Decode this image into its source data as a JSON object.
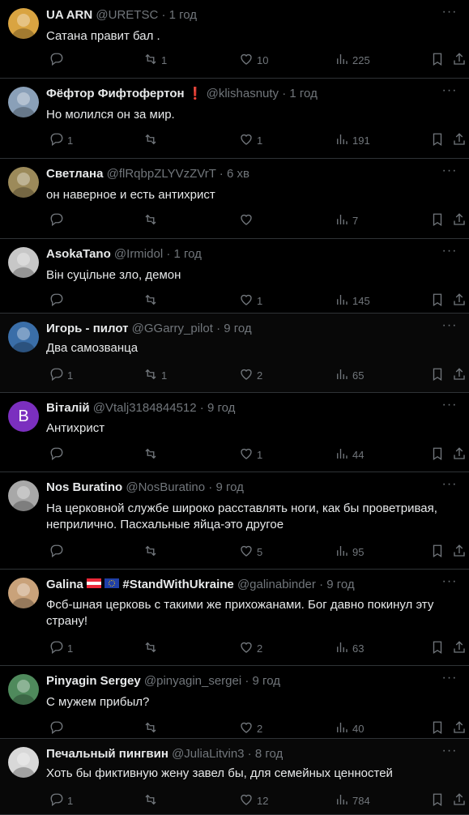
{
  "tweets": [
    {
      "name": "UA ARN",
      "handle": "@URETSC",
      "time": "1 год",
      "text": "Сатана правит бал .",
      "replies": "",
      "retweets": "1",
      "likes": "10",
      "views": "225",
      "avatar_color": "#d9a441"
    },
    {
      "name": "Фёфтор Фифтофертон",
      "handle": "@klishasnuty",
      "time": "1 год",
      "text": "Но молился он за мир.",
      "replies": "1",
      "retweets": "",
      "likes": "1",
      "views": "191",
      "avatar_color": "#8aa0b8",
      "badge": "❗"
    },
    {
      "name": "Светлана",
      "handle": "@flRqbpZLYVzZVrT",
      "time": "6 хв",
      "text": "он наверное и есть антихрист",
      "replies": "",
      "retweets": "",
      "likes": "",
      "views": "7",
      "avatar_color": "#9c8a5a"
    },
    {
      "name": "AsokaTano",
      "handle": "@Irmidol",
      "time": "1 год",
      "text": "Він суцільне зло, демон",
      "replies": "",
      "retweets": "",
      "likes": "1",
      "views": "145",
      "avatar_color": "#c7c7c7"
    },
    {
      "name": "Игорь - пилот",
      "handle": "@GGarry_pilot",
      "time": "9 год",
      "text": "Два самозванца",
      "replies": "1",
      "retweets": "1",
      "likes": "2",
      "views": "65",
      "avatar_color": "#3a6ea8"
    },
    {
      "name": "Віталій",
      "handle": "@Vtalj3184844512",
      "time": "9 год",
      "text": "Антихрист",
      "replies": "",
      "retweets": "",
      "likes": "1",
      "views": "44",
      "avatar_color": "#7b2fbf",
      "avatar_letter": "B"
    },
    {
      "name": "Nos Buratino",
      "handle": "@NosBuratino",
      "time": "9 год",
      "text": "На церковной службе широко расставлять ноги, как бы проветривая, неприлично. Пасхальные яйца-это другое",
      "replies": "",
      "retweets": "",
      "likes": "5",
      "views": "95",
      "avatar_color": "#a8a8a8"
    },
    {
      "name": "Galina",
      "name_suffix": "#StandWithUkraine",
      "handle": "@galinabinder",
      "time": "9 год",
      "text": "Фсб-шная церковь с такими же прихожанами. Бог давно покинул эту страну!",
      "replies": "1",
      "retweets": "",
      "likes": "2",
      "views": "63",
      "avatar_color": "#c9a27a"
    },
    {
      "name": "Pinyagin Sergey",
      "handle": "@pinyagin_sergei",
      "time": "9 год",
      "text": "С мужем прибыл?",
      "replies": "",
      "retweets": "",
      "likes": "2",
      "views": "40",
      "avatar_color": "#4f8a5c"
    },
    {
      "name": "Печальный пингвин",
      "handle": "@JuliaLitvin3",
      "time": "8 год",
      "text": "Хоть бы фиктивную жену завел бы, для семейных ценностей",
      "replies": "1",
      "retweets": "",
      "likes": "12",
      "views": "784",
      "avatar_color": "#d8d8d8"
    }
  ],
  "sep": "·",
  "more_label": "···"
}
